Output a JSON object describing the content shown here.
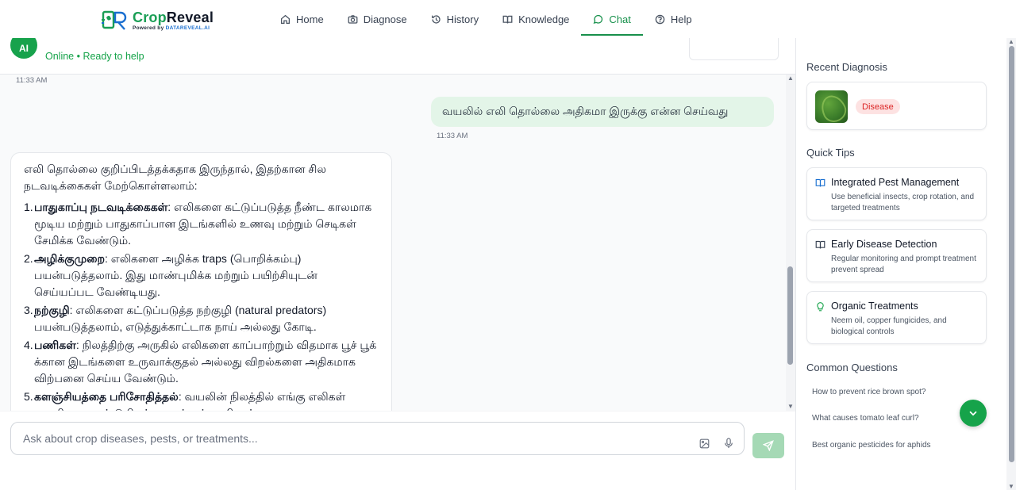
{
  "brand": {
    "name_part1": "Crop",
    "name_part2": "Reveal",
    "sub_prefix": "Powered by ",
    "sub_brand": "DATAREVEAL.AI"
  },
  "nav": {
    "home": "Home",
    "diagnose": "Diagnose",
    "history": "History",
    "knowledge": "Knowledge",
    "chat": "Chat",
    "help": "Help"
  },
  "chat_header": {
    "avatar_initials": "AI",
    "status": "Online • Ready to help"
  },
  "messages": {
    "ts_top": "11:33 AM",
    "user_text": "வயலில் எலி தொல்லை அதிகமா இருக்கு என்ன செய்வது",
    "user_ts": "11:33 AM",
    "bot_intro": "எலி தொல்லை குறிப்பிடத்தக்கதாக இருந்தால், இதற்கான சில நடவடிக்கைகள் மேற்கொள்ளலாம்:",
    "items": [
      {
        "num": "1.",
        "title": "பாதுகாப்பு நடவடிக்கைகள்",
        "text": ": எலிகளை கட்டுப்படுத்த நீண்ட காலமாக மூடிய மற்றும் பாதுகாப்பான இடங்களில் உணவு மற்றும் செடிகள் சேமிக்க வேண்டும்."
      },
      {
        "num": "2.",
        "title": "அழிக்குமுறை",
        "text": ": எலிகளை அழிக்க traps (பொறிக்கம்பு) பயன்படுத்தலாம். இது மாண்புமிக்க மற்றும் பயிற்சியுடன் செய்யப்பட வேண்டியது."
      },
      {
        "num": "3.",
        "title": "நற்குழி",
        "text": ": எலிகளை கட்டுப்படுத்த நற்குழி (natural predators) பயன்படுத்தலாம், எடுத்துக்காட்டாக நாய் அல்லது கோடி."
      },
      {
        "num": "4.",
        "title": "பணிகள்",
        "text": ": நிலத்திற்கு அருகில் எலிகளை காப்பாற்றும் விதமாக பூச் பூக் க்கான இடங்களை உருவாக்குதல் அல்லது விறல்களை அதிகமாக விற்பனை செய்ய வேண்டும்."
      },
      {
        "num": "5.",
        "title": "களஞ்சியத்தை பரிசோதித்தல்",
        "text": ": வயலின் நிலத்தில் எங்கு எலிகள் வருகிறதை கண்டுபிடிக்கு, அங்குள்ள விஷங்களை"
      }
    ]
  },
  "input": {
    "placeholder": "Ask about crop diseases, pests, or treatments..."
  },
  "sidebar": {
    "recent_title": "Recent Diagnosis",
    "recent_badge": "Disease",
    "tips_title": "Quick Tips",
    "tips": [
      {
        "title": "Integrated Pest Management",
        "desc": "Use beneficial insects, crop rotation, and targeted treatments",
        "icon": "book-icon"
      },
      {
        "title": "Early Disease Detection",
        "desc": "Regular monitoring and prompt treatment prevent spread",
        "icon": "book-icon"
      },
      {
        "title": "Organic Treatments",
        "desc": "Neem oil, copper fungicides, and biological controls",
        "icon": "lightbulb-icon"
      }
    ],
    "questions_title": "Common Questions",
    "questions": [
      "How to prevent rice brown spot?",
      "What causes tomato leaf curl?",
      "Best organic pesticides for aphids"
    ]
  },
  "colors": {
    "accent": "#17904b",
    "user_bubble": "#e3f5e8",
    "badge_bg": "#fde2e2",
    "badge_text": "#dc2626"
  }
}
